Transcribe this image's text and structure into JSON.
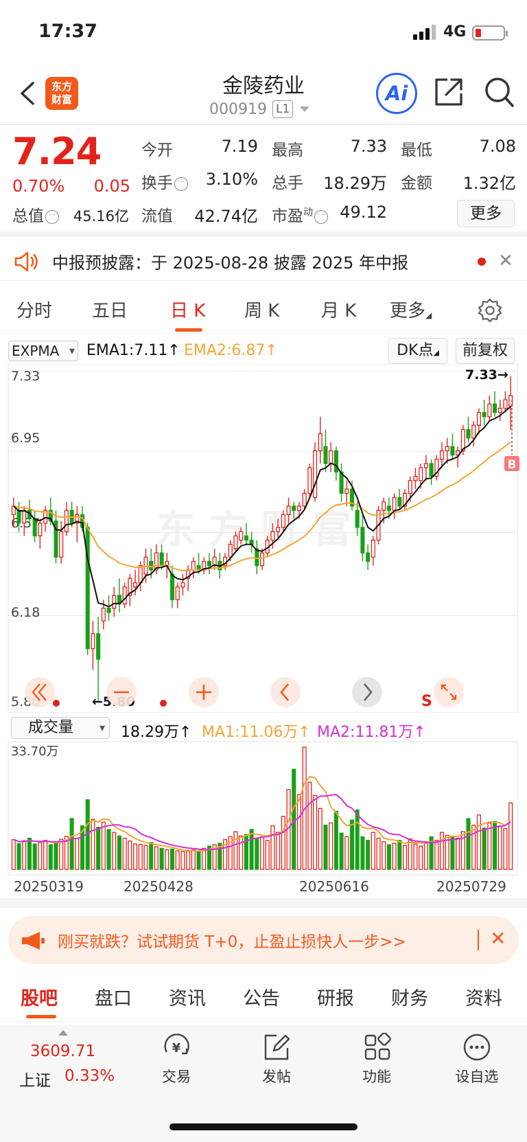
{
  "status": {
    "time": "17:37",
    "network": "4G"
  },
  "nav": {
    "brand": [
      "东方",
      "财富"
    ],
    "stock_name": "金陵药业",
    "stock_code": "000919",
    "level": "L1",
    "ai_label": "Ai"
  },
  "quote": {
    "price": "7.24",
    "change_pct": "0.70%",
    "change_abs": "0.05",
    "open": {
      "label": "今开",
      "value": "7.19"
    },
    "high": {
      "label": "最高",
      "value": "7.33"
    },
    "low": {
      "label": "最低",
      "value": "7.08"
    },
    "turnover": {
      "label": "换手",
      "value": "3.10%"
    },
    "volume": {
      "label": "总手",
      "value": "18.29万"
    },
    "amount": {
      "label": "金额",
      "value": "1.32亿"
    },
    "market_cap": {
      "label": "总值",
      "value": "45.16亿"
    },
    "float_cap": {
      "label": "流值",
      "value": "42.74亿"
    },
    "pe": {
      "label": "市盈",
      "sup": "动",
      "value": "49.12"
    },
    "more_label": "更多"
  },
  "notice": {
    "text": "中报预披露：于 2025-08-28 披露 2025 年中报"
  },
  "chart_tabs": [
    "分时",
    "五日",
    "日 K",
    "周 K",
    "月 K",
    "更多"
  ],
  "indicator": {
    "name": "EXPMA",
    "ema1": "EMA1:7.11↑",
    "ema2": "EMA2:6.87↑",
    "dk_label": "DK点",
    "adjust_label": "前复权"
  },
  "kline": {
    "y_labels": [
      "7.33",
      "6.95",
      "6.57",
      "6.18",
      "5.80"
    ],
    "max_marker": "7.33→",
    "min_marker": "←5.80",
    "b_marker": "B",
    "s_marker": "S",
    "watermark": "东方财富"
  },
  "volume": {
    "selector": "成交量",
    "current": "18.29万↑",
    "ma1": "MA1:11.06万↑",
    "ma2": "MA2:11.81万↑",
    "max_label": "33.70万",
    "dates": [
      "20250319",
      "20250428",
      "20250616",
      "20250729"
    ]
  },
  "chart_data": {
    "type": "candlestick",
    "ylim": [
      5.8,
      7.33
    ],
    "ohlc": [
      [
        6.68,
        6.76,
        6.62,
        6.72
      ],
      [
        6.7,
        6.74,
        6.6,
        6.64
      ],
      [
        6.64,
        6.72,
        6.58,
        6.7
      ],
      [
        6.7,
        6.75,
        6.62,
        6.66
      ],
      [
        6.66,
        6.7,
        6.55,
        6.58
      ],
      [
        6.58,
        6.66,
        6.52,
        6.64
      ],
      [
        6.64,
        6.72,
        6.6,
        6.7
      ],
      [
        6.7,
        6.76,
        6.63,
        6.65
      ],
      [
        6.65,
        6.7,
        6.45,
        6.48
      ],
      [
        6.48,
        6.65,
        6.45,
        6.6
      ],
      [
        6.6,
        6.74,
        6.58,
        6.7
      ],
      [
        6.7,
        6.74,
        6.62,
        6.64
      ],
      [
        6.64,
        6.72,
        6.55,
        6.68
      ],
      [
        6.68,
        6.72,
        6.6,
        6.62
      ],
      [
        6.62,
        6.64,
        6.02,
        6.05
      ],
      [
        6.05,
        6.18,
        5.95,
        6.12
      ],
      [
        6.12,
        6.2,
        5.8,
        6.0
      ],
      [
        6.18,
        6.28,
        6.14,
        6.24
      ],
      [
        6.24,
        6.3,
        6.18,
        6.22
      ],
      [
        6.24,
        6.34,
        6.2,
        6.3
      ],
      [
        6.3,
        6.38,
        6.22,
        6.26
      ],
      [
        6.26,
        6.36,
        6.24,
        6.34
      ],
      [
        6.3,
        6.4,
        6.25,
        6.38
      ],
      [
        6.34,
        6.42,
        6.3,
        6.36
      ],
      [
        6.36,
        6.46,
        6.32,
        6.44
      ],
      [
        6.4,
        6.52,
        6.36,
        6.48
      ],
      [
        6.46,
        6.52,
        6.38,
        6.42
      ],
      [
        6.42,
        6.54,
        6.4,
        6.5
      ],
      [
        6.5,
        6.54,
        6.42,
        6.44
      ],
      [
        6.44,
        6.5,
        6.38,
        6.46
      ],
      [
        6.4,
        6.44,
        6.24,
        6.28
      ],
      [
        6.28,
        6.36,
        6.24,
        6.34
      ],
      [
        6.34,
        6.4,
        6.3,
        6.36
      ],
      [
        6.38,
        6.44,
        6.32,
        6.42
      ],
      [
        6.42,
        6.48,
        6.38,
        6.46
      ],
      [
        6.44,
        6.5,
        6.4,
        6.42
      ],
      [
        6.42,
        6.48,
        6.4,
        6.46
      ],
      [
        6.46,
        6.5,
        6.4,
        6.44
      ],
      [
        6.44,
        6.52,
        6.42,
        6.48
      ],
      [
        6.46,
        6.5,
        6.38,
        6.42
      ],
      [
        6.44,
        6.5,
        6.42,
        6.48
      ],
      [
        6.48,
        6.56,
        6.46,
        6.54
      ],
      [
        6.52,
        6.6,
        6.5,
        6.58
      ],
      [
        6.56,
        6.62,
        6.54,
        6.6
      ],
      [
        6.58,
        6.64,
        6.54,
        6.56
      ],
      [
        6.56,
        6.6,
        6.5,
        6.54
      ],
      [
        6.52,
        6.56,
        6.4,
        6.44
      ],
      [
        6.44,
        6.52,
        6.42,
        6.5
      ],
      [
        6.5,
        6.58,
        6.48,
        6.56
      ],
      [
        6.56,
        6.64,
        6.52,
        6.6
      ],
      [
        6.6,
        6.66,
        6.56,
        6.62
      ],
      [
        6.62,
        6.7,
        6.6,
        6.68
      ],
      [
        6.68,
        6.76,
        6.64,
        6.72
      ],
      [
        6.72,
        6.74,
        6.66,
        6.7
      ],
      [
        6.7,
        6.74,
        6.66,
        6.72
      ],
      [
        6.72,
        6.8,
        6.7,
        6.78
      ],
      [
        6.78,
        6.92,
        6.76,
        6.9
      ],
      [
        6.76,
        7.02,
        6.74,
        6.98
      ],
      [
        6.98,
        7.14,
        6.92,
        7.06
      ],
      [
        7.0,
        7.08,
        6.88,
        6.92
      ],
      [
        6.92,
        7.02,
        6.88,
        6.98
      ],
      [
        6.98,
        7.0,
        6.84,
        6.88
      ],
      [
        6.88,
        6.92,
        6.74,
        6.78
      ],
      [
        6.78,
        6.84,
        6.72,
        6.8
      ],
      [
        6.8,
        6.84,
        6.7,
        6.72
      ],
      [
        6.7,
        6.74,
        6.58,
        6.62
      ],
      [
        6.62,
        6.68,
        6.46,
        6.5
      ],
      [
        6.5,
        6.54,
        6.42,
        6.46
      ],
      [
        6.48,
        6.58,
        6.44,
        6.56
      ],
      [
        6.56,
        6.72,
        6.54,
        6.7
      ],
      [
        6.7,
        6.76,
        6.64,
        6.74
      ],
      [
        6.72,
        6.76,
        6.66,
        6.7
      ],
      [
        6.7,
        6.78,
        6.66,
        6.76
      ],
      [
        6.76,
        6.8,
        6.7,
        6.72
      ],
      [
        6.72,
        6.8,
        6.7,
        6.78
      ],
      [
        6.78,
        6.86,
        6.74,
        6.84
      ],
      [
        6.84,
        6.9,
        6.8,
        6.86
      ],
      [
        6.84,
        6.92,
        6.8,
        6.9
      ],
      [
        6.9,
        6.96,
        6.84,
        6.92
      ],
      [
        6.92,
        6.94,
        6.82,
        6.86
      ],
      [
        6.86,
        6.96,
        6.84,
        6.94
      ],
      [
        6.94,
        7.02,
        6.9,
        6.98
      ],
      [
        6.98,
        7.04,
        6.92,
        7.0
      ],
      [
        7.0,
        7.06,
        6.94,
        6.96
      ],
      [
        6.96,
        7.0,
        6.9,
        6.98
      ],
      [
        6.98,
        7.1,
        6.96,
        7.08
      ],
      [
        7.08,
        7.14,
        7.02,
        7.04
      ],
      [
        7.04,
        7.12,
        7.0,
        7.1
      ],
      [
        7.1,
        7.18,
        7.06,
        7.16
      ],
      [
        7.16,
        7.22,
        7.1,
        7.14
      ],
      [
        7.14,
        7.24,
        7.12,
        7.2
      ],
      [
        7.2,
        7.26,
        7.14,
        7.16
      ],
      [
        7.16,
        7.22,
        7.12,
        7.18
      ],
      [
        7.18,
        7.26,
        7.16,
        7.22
      ],
      [
        7.19,
        7.33,
        7.08,
        7.24
      ]
    ],
    "volumes": [
      8.2,
      7.1,
      7.9,
      8.6,
      7.0,
      7.4,
      8.0,
      6.8,
      7.6,
      8.3,
      9.1,
      14.0,
      8.6,
      12.0,
      19.2,
      13.8,
      11.6,
      13.0,
      11.0,
      10.2,
      9.2,
      8.6,
      7.8,
      7.0,
      6.9,
      6.6,
      7.4,
      6.2,
      5.8,
      5.4,
      5.6,
      5.1,
      4.9,
      5.0,
      5.4,
      5.0,
      5.8,
      6.4,
      6.8,
      7.2,
      8.2,
      9.0,
      10.4,
      9.2,
      9.6,
      11.0,
      8.4,
      9.0,
      8.0,
      12.0,
      10.2,
      14.6,
      22.0,
      27.6,
      20.6,
      33.7,
      24.0,
      20.4,
      16.8,
      12.2,
      12.8,
      16.0,
      10.0,
      9.0,
      13.6,
      16.4,
      9.0,
      8.0,
      10.2,
      8.6,
      7.6,
      6.8,
      7.2,
      8.0,
      6.6,
      8.4,
      7.0,
      6.4,
      7.6,
      9.0,
      8.0,
      10.2,
      9.4,
      9.2,
      8.6,
      10.4,
      14.0,
      12.2,
      15.0,
      11.4,
      12.8,
      13.2,
      12.0,
      11.2,
      18.3
    ]
  },
  "section_tabs": [
    "股吧",
    "盘口",
    "资讯",
    "公告",
    "研报",
    "财务",
    "资料"
  ],
  "bottom": {
    "index_value": "3609.71",
    "index_name": "上证",
    "index_pct": "0.33%",
    "items": [
      "交易",
      "发帖",
      "功能",
      "设自选"
    ]
  },
  "ad": {
    "text": "刚买就跌？试试期货 T+0，止盈止损快人一步>>"
  },
  "colors": {
    "up": "#e2231a",
    "down": "#18a118",
    "ema2": "#f3a534",
    "ma2": "#d62fd6",
    "brand": "#f25a1a",
    "ai": "#2a64f5"
  }
}
